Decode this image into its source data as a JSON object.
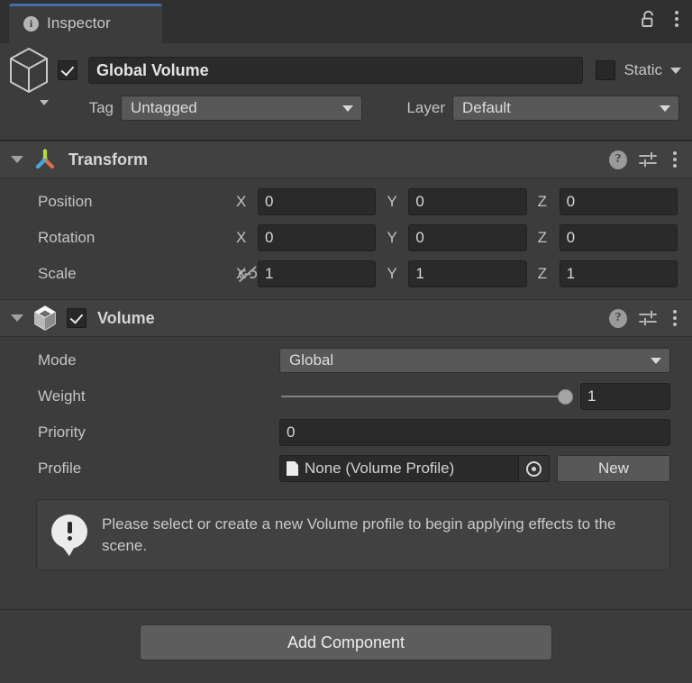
{
  "window": {
    "tab_label": "Inspector",
    "tab_icon": "info-circle-icon",
    "info_glyph": "i",
    "lock_icon": "padlock-unlocked-icon",
    "menu_icon": "kebab-menu-icon",
    "accent_color": "#3f6ea8",
    "background_color": "#3c3c3c",
    "header_color": "#414141"
  },
  "gameobject": {
    "icon": "cube-gameobject-icon",
    "enabled": true,
    "name": "Global Volume",
    "static_label": "Static",
    "static_checked": false,
    "tag_label": "Tag",
    "tag_value": "Untagged",
    "layer_label": "Layer",
    "layer_value": "Default"
  },
  "components": [
    {
      "name": "Transform",
      "icon": "transform-axis-gizmo-icon",
      "expanded": true,
      "has_enable_toggle": false,
      "help_glyph": "?",
      "rows": [
        {
          "label": "Position",
          "axes": [
            {
              "letter": "X",
              "value": "0"
            },
            {
              "letter": "Y",
              "value": "0"
            },
            {
              "letter": "Z",
              "value": "0"
            }
          ]
        },
        {
          "label": "Rotation",
          "axes": [
            {
              "letter": "X",
              "value": "0"
            },
            {
              "letter": "Y",
              "value": "0"
            },
            {
              "letter": "Z",
              "value": "0"
            }
          ]
        },
        {
          "label": "Scale",
          "constrain_icon": "linked-chain-off-icon",
          "axes": [
            {
              "letter": "X",
              "value": "1"
            },
            {
              "letter": "Y",
              "value": "1"
            },
            {
              "letter": "Z",
              "value": "1"
            }
          ]
        }
      ]
    },
    {
      "name": "Volume",
      "icon": "volume-cube-icon",
      "expanded": true,
      "has_enable_toggle": true,
      "enabled": true,
      "help_glyph": "?"
    }
  ],
  "volume": {
    "mode_label": "Mode",
    "mode_value": "Global",
    "weight_label": "Weight",
    "weight_value": "1",
    "weight_percent": 100,
    "priority_label": "Priority",
    "priority_value": "0",
    "profile_label": "Profile",
    "profile_value": "None (Volume Profile)",
    "profile_icon": "document-icon",
    "picker_icon": "object-picker-icon",
    "new_button_label": "New"
  },
  "helpbox": {
    "icon": "speech-bubble-warning-icon",
    "message": "Please select or create a new Volume profile to begin applying effects to the scene."
  },
  "footer": {
    "add_component_label": "Add Component"
  }
}
